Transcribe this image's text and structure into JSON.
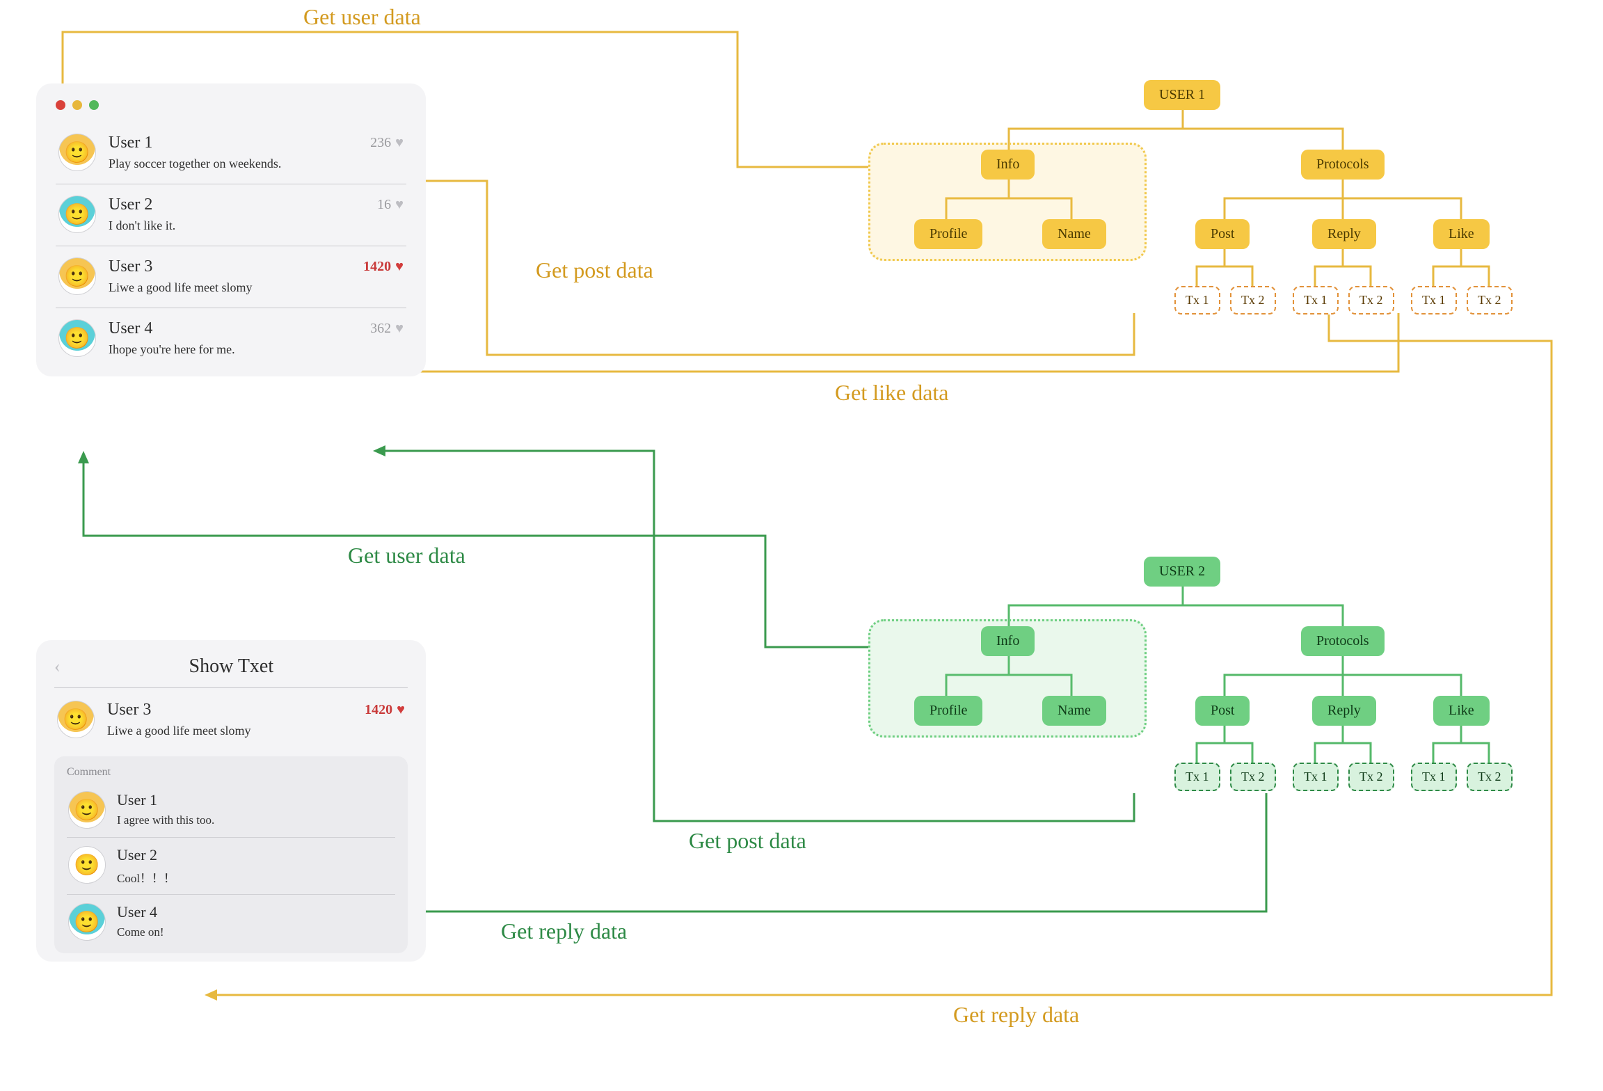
{
  "colors": {
    "yellow": "#f6c844",
    "green": "#6fcf82",
    "red": "#d23c3c",
    "gray": "#bdbdc2"
  },
  "feed": {
    "posts": [
      {
        "user": "User 1",
        "text": "Play soccer together on weekends.",
        "likes": "236",
        "likeColor": "gray",
        "avatar": "orange"
      },
      {
        "user": "User 2",
        "text": "I don't like it.",
        "likes": "16",
        "likeColor": "gray",
        "avatar": "blue"
      },
      {
        "user": "User 3",
        "text": "Liwe a good life meet slomy",
        "likes": "1420",
        "likeColor": "red",
        "avatar": "orange"
      },
      {
        "user": "User 4",
        "text": "Ihope you're here for me.",
        "likes": "362",
        "likeColor": "gray",
        "avatar": "blue"
      }
    ]
  },
  "detail": {
    "title": "Show Txet",
    "post": {
      "user": "User 3",
      "text": "Liwe a good life meet slomy",
      "likes": "1420",
      "likeColor": "red",
      "avatar": "orange"
    },
    "commentsLabel": "Comment",
    "comments": [
      {
        "user": "User 1",
        "text": "I agree with this too.",
        "avatar": "orange"
      },
      {
        "user": "User 2",
        "text": "Cool！！！",
        "avatar": "white"
      },
      {
        "user": "User 4",
        "text": "Come on!",
        "avatar": "blue"
      }
    ]
  },
  "tree1": {
    "root": "USER 1",
    "info": "Info",
    "profile": "Profile",
    "name": "Name",
    "protocols": "Protocols",
    "post": "Post",
    "reply": "Reply",
    "like": "Like",
    "tx1": "Tx 1",
    "tx2": "Tx 2"
  },
  "tree2": {
    "root": "USER 2",
    "info": "Info",
    "profile": "Profile",
    "name": "Name",
    "protocols": "Protocols",
    "post": "Post",
    "reply": "Reply",
    "like": "Like",
    "tx1": "Tx 1",
    "tx2": "Tx 2"
  },
  "flows": {
    "getUserData1": "Get user data",
    "getPostData1": "Get post data",
    "getLikeData": "Get like data",
    "getUserData2": "Get user data",
    "getPostData2": "Get post data",
    "getReplyData1": "Get reply data",
    "getReplyData2": "Get reply data"
  }
}
